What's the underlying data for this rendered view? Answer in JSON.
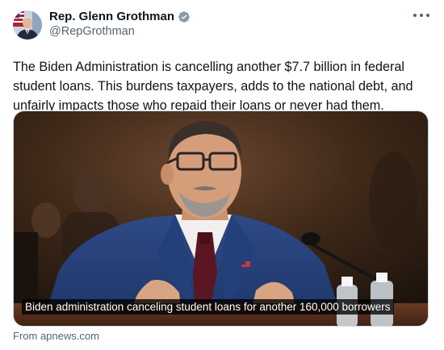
{
  "author": {
    "display_name": "Rep. Glenn Grothman",
    "handle": "@RepGrothman",
    "avatar_icon": "profile-photo",
    "verified_icon": "verified-badge-icon",
    "verified_color": "#829aab"
  },
  "tweet": {
    "text": "The Biden Administration is cancelling another $7.7 billion in federal student loans. This burdens taxpayers, adds to the national debt, and unfairly impacts those who repaid their loans or never had them."
  },
  "media": {
    "caption": "Biden administration canceling student loans for another 160,000 borrowers"
  },
  "link_card": {
    "source": "From apnews.com"
  },
  "more_icon": "more-options-icon"
}
